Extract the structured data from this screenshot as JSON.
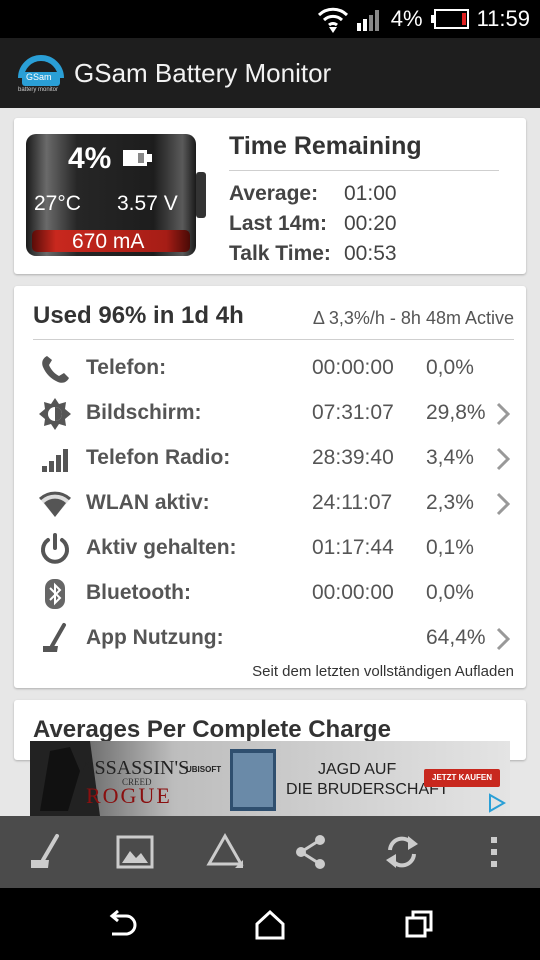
{
  "status_bar": {
    "battery_pct": "4%",
    "time": "11:59"
  },
  "app": {
    "title": "GSam Battery Monitor",
    "logo_text": "GSam",
    "logo_sub": "battery monitor"
  },
  "battery": {
    "percent": "4%",
    "level": 0.04,
    "temperature": "27°C",
    "voltage": "3.57 V",
    "current": "670 mA"
  },
  "time_remaining": {
    "title": "Time Remaining",
    "rows": [
      {
        "label": "Average:",
        "value": "01:00"
      },
      {
        "label": "Last 14m:",
        "value": "00:20"
      },
      {
        "label": "Talk Time:",
        "value": "00:53"
      }
    ]
  },
  "usage": {
    "title": "Used 96% in 1d 4h",
    "subtitle": "Δ 3,3%/h - 8h 48m Active",
    "rows": [
      {
        "icon": "phone-icon",
        "label": "Telefon:",
        "time": "00:00:00",
        "pct": "0,0%",
        "chevron": false
      },
      {
        "icon": "brightness-icon",
        "label": "Bildschirm:",
        "time": "07:31:07",
        "pct": "29,8%",
        "chevron": true
      },
      {
        "icon": "signal-icon",
        "label": "Telefon Radio:",
        "time": "28:39:40",
        "pct": "3,4%",
        "chevron": true
      },
      {
        "icon": "wifi-icon",
        "label": "WLAN aktiv:",
        "time": "24:11:07",
        "pct": "2,3%",
        "chevron": true
      },
      {
        "icon": "power-icon",
        "label": "Aktiv gehalten:",
        "time": "01:17:44",
        "pct": "0,1%",
        "chevron": false
      },
      {
        "icon": "bluetooth-icon",
        "label": "Bluetooth:",
        "time": "00:00:00",
        "pct": "0,0%",
        "chevron": false
      },
      {
        "icon": "app-usage-icon",
        "label": "App Nutzung:",
        "time": "",
        "pct": "64,4%",
        "chevron": true
      }
    ],
    "footer": "Seit dem letzten vollständigen Aufladen"
  },
  "averages": {
    "title": "Averages Per Complete Charge"
  },
  "ad": {
    "brand_line1": "ASSASSIN'S",
    "brand_line2": "CREED",
    "brand_line3": "ROGUE",
    "publisher": "UBISOFT",
    "headline1": "JAGD AUF",
    "headline2": "DIE BRUDERSCHAFT",
    "cta": "JETZT KAUFEN"
  },
  "bottom_bar": {
    "icons": [
      "app-usage-icon",
      "image-icon",
      "triangle-icon",
      "share-icon",
      "refresh-icon",
      "overflow-menu-icon"
    ]
  },
  "nav_bar": {
    "icons": [
      "back-icon",
      "home-icon",
      "recents-icon"
    ]
  },
  "colors": {
    "accent": "#2a9fd6",
    "battery_red": "#c8281e",
    "card_bg": "#ffffff",
    "page_bg": "#e7e7e7"
  }
}
